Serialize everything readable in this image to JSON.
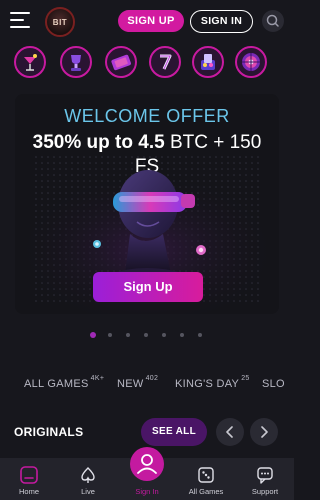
{
  "header": {
    "logo_text": "BIT",
    "signup_label": "SIGN UP",
    "signin_label": "SIGN IN"
  },
  "categories": [
    {
      "icon": "cocktail-icon"
    },
    {
      "icon": "trophy-icon"
    },
    {
      "icon": "ticket-icon"
    },
    {
      "icon": "lucky-seven-icon"
    },
    {
      "icon": "card-game-icon"
    },
    {
      "icon": "roulette-icon"
    }
  ],
  "banner": {
    "title": "WELCOME OFFER",
    "offer_bold": "350% up to 4.5",
    "offer_rest": " BTC + 150 FS",
    "cta": "Sign Up"
  },
  "pager": {
    "count": 7,
    "active": 0
  },
  "tabs": [
    {
      "label": "ALL GAMES",
      "count": "4K+"
    },
    {
      "label": "NEW",
      "count": "402"
    },
    {
      "label": "KING'S DAY",
      "count": "25"
    },
    {
      "label": "SLO",
      "count": ""
    }
  ],
  "originals": {
    "title": "ORIGINALS",
    "see_all": "SEE ALL"
  },
  "bottom_nav": {
    "home": "Home",
    "live": "Live",
    "signin": "Sign In",
    "all_games": "All Games",
    "support": "Support"
  },
  "colors": {
    "accent": "#d21aa0",
    "background": "#17171d",
    "offer_title": "#6bc6ea"
  }
}
